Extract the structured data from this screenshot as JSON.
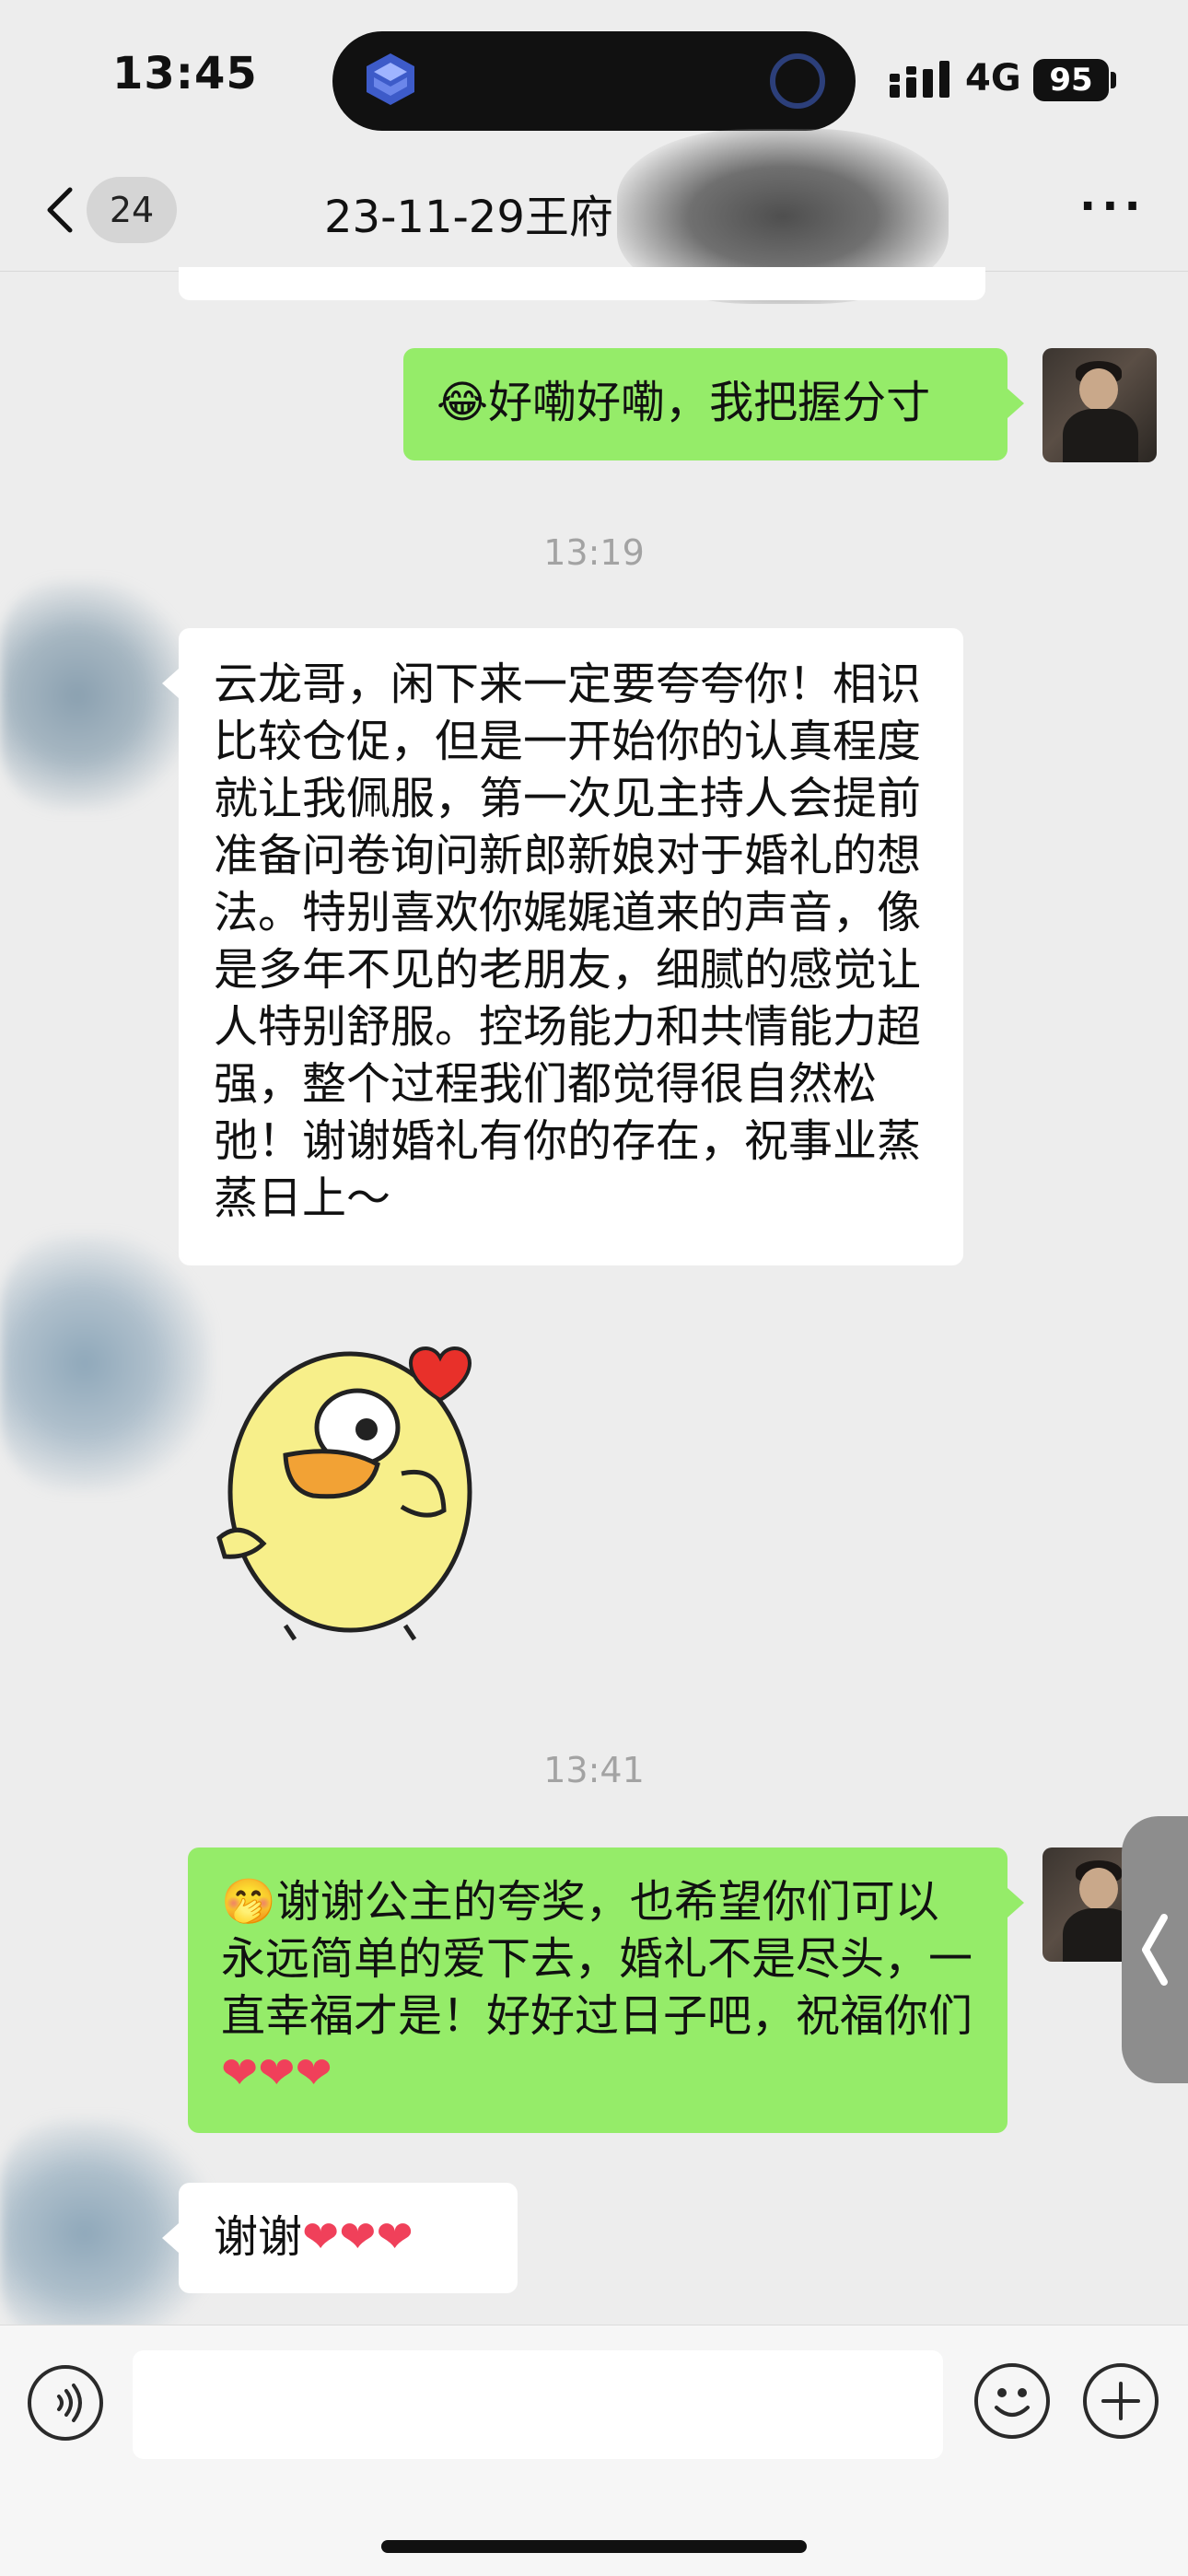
{
  "status_bar": {
    "time": "13:45",
    "network": "4G",
    "battery": "95"
  },
  "nav": {
    "unread_count": "24",
    "title": "23-11-29王府",
    "back_icon": "chevron-left-icon",
    "more_icon": "more-dots-icon",
    "more_label": "···"
  },
  "messages": {
    "m1": {
      "sender": "me",
      "text": "😂好嘞好嘞，我把握分寸"
    },
    "ts1": "13:19",
    "m2": {
      "sender": "other",
      "text": "云龙哥，闲下来一定要夸夸你！相识比较仓促，但是一开始你的认真程度就让我佩服，第一次见主持人会提前准备问卷询问新郎新娘对于婚礼的想法。特别喜欢你娓娓道来的声音，像是多年不见的老朋友，细腻的感觉让人特别舒服。控场能力和共情能力超强，整个过程我们都觉得很自然松弛！谢谢婚礼有你的存在，祝事业蒸蒸日上～"
    },
    "m3": {
      "sender": "other",
      "type": "sticker",
      "sticker": "duck-heart-sticker"
    },
    "ts2": "13:41",
    "m4": {
      "sender": "me",
      "text": "🤭谢谢公主的夸奖，也希望你们可以永远简单的爱下去，婚礼不是尽头，一直幸福才是！好好过日子吧，祝福你们",
      "hearts": "❤❤❤"
    },
    "m5": {
      "sender": "other",
      "text": "谢谢",
      "hearts": "❤❤❤"
    }
  },
  "input_bar": {
    "voice_icon": "voice-icon",
    "emoji_icon": "emoji-icon",
    "plus_icon": "plus-icon"
  },
  "colors": {
    "background": "#ededed",
    "bubble_me": "#95ec69",
    "bubble_other": "#ffffff",
    "timestamp": "#a3a3a3"
  }
}
